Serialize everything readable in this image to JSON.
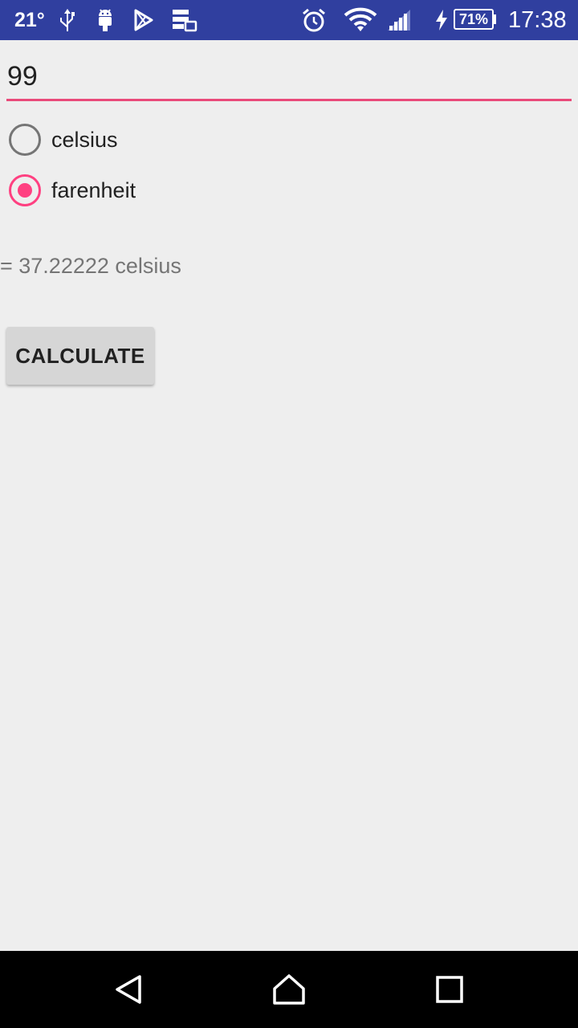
{
  "status_bar": {
    "temperature": "21°",
    "clock": "17:38",
    "battery": "71%",
    "icons": [
      "usb-icon",
      "android-debug-icon",
      "play-store-icon",
      "storage-icon",
      "alarm-icon",
      "wifi-icon",
      "signal-icon",
      "charging-icon",
      "battery-icon"
    ]
  },
  "form": {
    "input_value": "99",
    "options": [
      {
        "label": "celsius",
        "checked": false
      },
      {
        "label": "farenheit",
        "checked": true
      }
    ],
    "result": "= 37.22222 celsius",
    "button_label": "CALCULATE"
  },
  "nav_bar": {
    "icons": [
      "back-icon",
      "home-icon",
      "recents-icon"
    ]
  },
  "colors": {
    "status_bar": "#303f9f",
    "accent": "#ff4081",
    "background": "#eeeeee",
    "button": "#d6d6d6"
  }
}
